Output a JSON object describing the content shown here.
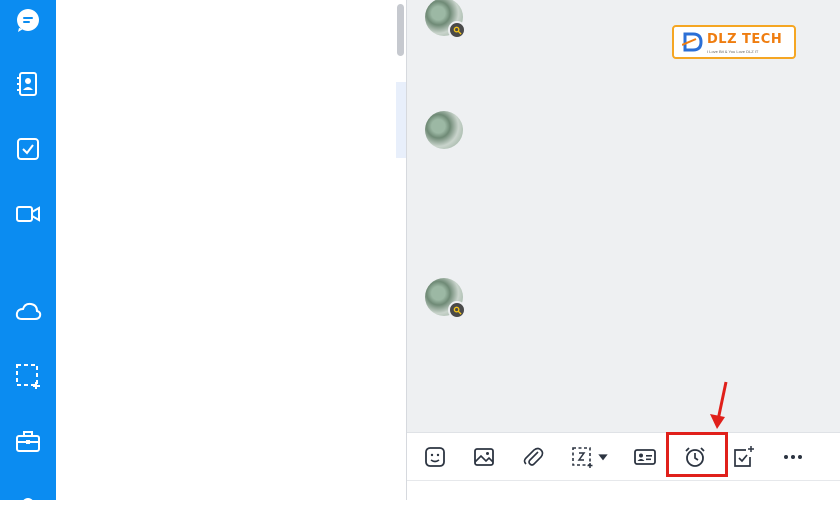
{
  "colors": {
    "sidebar": "#0b8cf1",
    "chat_background": "#eef0f2",
    "highlight": "#e0201b",
    "logo_orange": "#ef7d10",
    "logo_border": "#f5a623"
  },
  "sidebar": {
    "items": [
      {
        "icon": "chat-icon"
      },
      {
        "icon": "contacts-icon"
      },
      {
        "icon": "todo-icon"
      },
      {
        "icon": "video-call-icon"
      },
      {
        "icon": "cloud-icon"
      },
      {
        "icon": "screenshot-icon"
      },
      {
        "icon": "briefcase-icon"
      }
    ]
  },
  "watermark": {
    "brand": "DLZ TECH",
    "tagline": "I Love Bit & You Love DLZ IT"
  },
  "toolbar": {
    "buttons": [
      {
        "icon": "sticker-icon"
      },
      {
        "icon": "image-icon"
      },
      {
        "icon": "attachment-icon"
      },
      {
        "icon": "screenshot-icon"
      },
      {
        "icon": "dropdown-caret-icon"
      },
      {
        "icon": "contact-card-icon"
      },
      {
        "icon": "reminder-alarm-icon",
        "highlighted": true
      },
      {
        "icon": "task-assign-icon"
      },
      {
        "icon": "more-icon"
      }
    ]
  }
}
